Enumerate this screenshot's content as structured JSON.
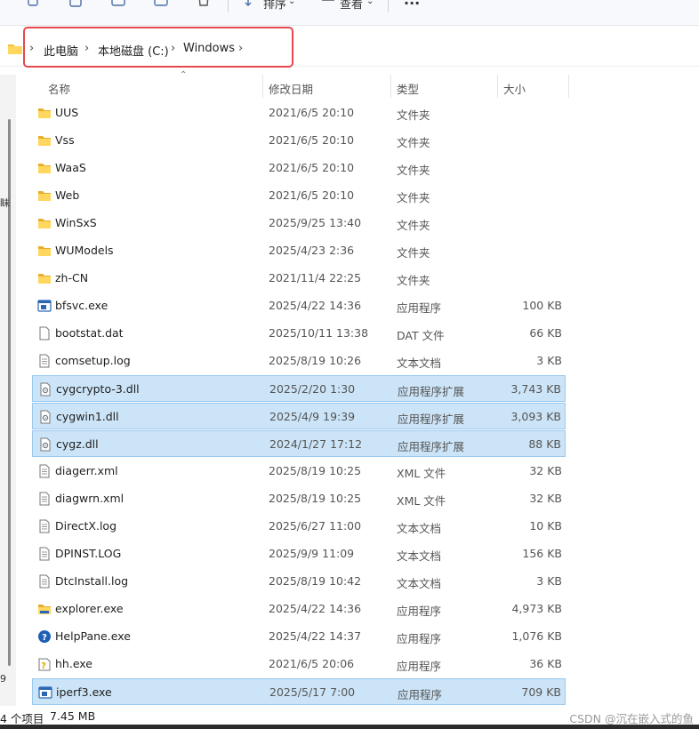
{
  "toolbar": {
    "sort_label": "排序",
    "view_label": "查看",
    "more_label": "..."
  },
  "address": {
    "segments": [
      "此电脑",
      "本地磁盘 (C:)",
      "Windows"
    ]
  },
  "nav_fragments": [
    "眛",
    "9"
  ],
  "columns": {
    "name": "名称",
    "date": "修改日期",
    "type": "类型",
    "size": "大小"
  },
  "files": [
    {
      "name": "UUS",
      "date": "2021/6/5 20:10",
      "type": "文件夹",
      "size": "",
      "icon": "folder-icon",
      "selected": false
    },
    {
      "name": "Vss",
      "date": "2021/6/5 20:10",
      "type": "文件夹",
      "size": "",
      "icon": "folder-icon",
      "selected": false
    },
    {
      "name": "WaaS",
      "date": "2021/6/5 20:10",
      "type": "文件夹",
      "size": "",
      "icon": "folder-icon",
      "selected": false
    },
    {
      "name": "Web",
      "date": "2021/6/5 20:10",
      "type": "文件夹",
      "size": "",
      "icon": "folder-icon",
      "selected": false
    },
    {
      "name": "WinSxS",
      "date": "2025/9/25 13:40",
      "type": "文件夹",
      "size": "",
      "icon": "folder-icon",
      "selected": false
    },
    {
      "name": "WUModels",
      "date": "2025/4/23 2:36",
      "type": "文件夹",
      "size": "",
      "icon": "folder-icon",
      "selected": false
    },
    {
      "name": "zh-CN",
      "date": "2021/11/4 22:25",
      "type": "文件夹",
      "size": "",
      "icon": "folder-icon",
      "selected": false
    },
    {
      "name": "bfsvc.exe",
      "date": "2025/4/22 14:36",
      "type": "应用程序",
      "size": "100 KB",
      "icon": "app-exe-icon",
      "selected": false
    },
    {
      "name": "bootstat.dat",
      "date": "2025/10/11 13:38",
      "type": "DAT 文件",
      "size": "66 KB",
      "icon": "blank-file-icon",
      "selected": false
    },
    {
      "name": "comsetup.log",
      "date": "2025/8/19 10:26",
      "type": "文本文档",
      "size": "3 KB",
      "icon": "text-file-icon",
      "selected": false
    },
    {
      "name": "cygcrypto-3.dll",
      "date": "2025/2/20 1:30",
      "type": "应用程序扩展",
      "size": "3,743 KB",
      "icon": "dll-file-icon",
      "selected": true
    },
    {
      "name": "cygwin1.dll",
      "date": "2025/4/9 19:39",
      "type": "应用程序扩展",
      "size": "3,093 KB",
      "icon": "dll-file-icon",
      "selected": true
    },
    {
      "name": "cygz.dll",
      "date": "2024/1/27 17:12",
      "type": "应用程序扩展",
      "size": "88 KB",
      "icon": "dll-file-icon",
      "selected": true
    },
    {
      "name": "diagerr.xml",
      "date": "2025/8/19 10:25",
      "type": "XML 文件",
      "size": "32 KB",
      "icon": "text-file-icon",
      "selected": false
    },
    {
      "name": "diagwrn.xml",
      "date": "2025/8/19 10:25",
      "type": "XML 文件",
      "size": "32 KB",
      "icon": "text-file-icon",
      "selected": false
    },
    {
      "name": "DirectX.log",
      "date": "2025/6/27 11:00",
      "type": "文本文档",
      "size": "10 KB",
      "icon": "text-file-icon",
      "selected": false
    },
    {
      "name": "DPINST.LOG",
      "date": "2025/9/9 11:09",
      "type": "文本文档",
      "size": "156 KB",
      "icon": "text-file-icon",
      "selected": false
    },
    {
      "name": "DtcInstall.log",
      "date": "2025/8/19 10:42",
      "type": "文本文档",
      "size": "3 KB",
      "icon": "text-file-icon",
      "selected": false
    },
    {
      "name": "explorer.exe",
      "date": "2025/4/22 14:36",
      "type": "应用程序",
      "size": "4,973 KB",
      "icon": "explorer-folder-icon",
      "selected": false
    },
    {
      "name": "HelpPane.exe",
      "date": "2025/4/22 14:37",
      "type": "应用程序",
      "size": "1,076 KB",
      "icon": "help-icon",
      "selected": false
    },
    {
      "name": "hh.exe",
      "date": "2021/6/5 20:06",
      "type": "应用程序",
      "size": "36 KB",
      "icon": "help-doc-icon",
      "selected": false
    },
    {
      "name": "iperf3.exe",
      "date": "2025/5/17 7:00",
      "type": "应用程序",
      "size": "709 KB",
      "icon": "app-exe-icon",
      "selected": true
    }
  ],
  "status": {
    "count": "4 个项目",
    "size": "7.45 MB"
  },
  "watermark": "CSDN @沉在嵌入式的鱼",
  "colors": {
    "selection": "#cce4f7",
    "highlight_box": "#e5484d",
    "folder": "#f5c242"
  }
}
